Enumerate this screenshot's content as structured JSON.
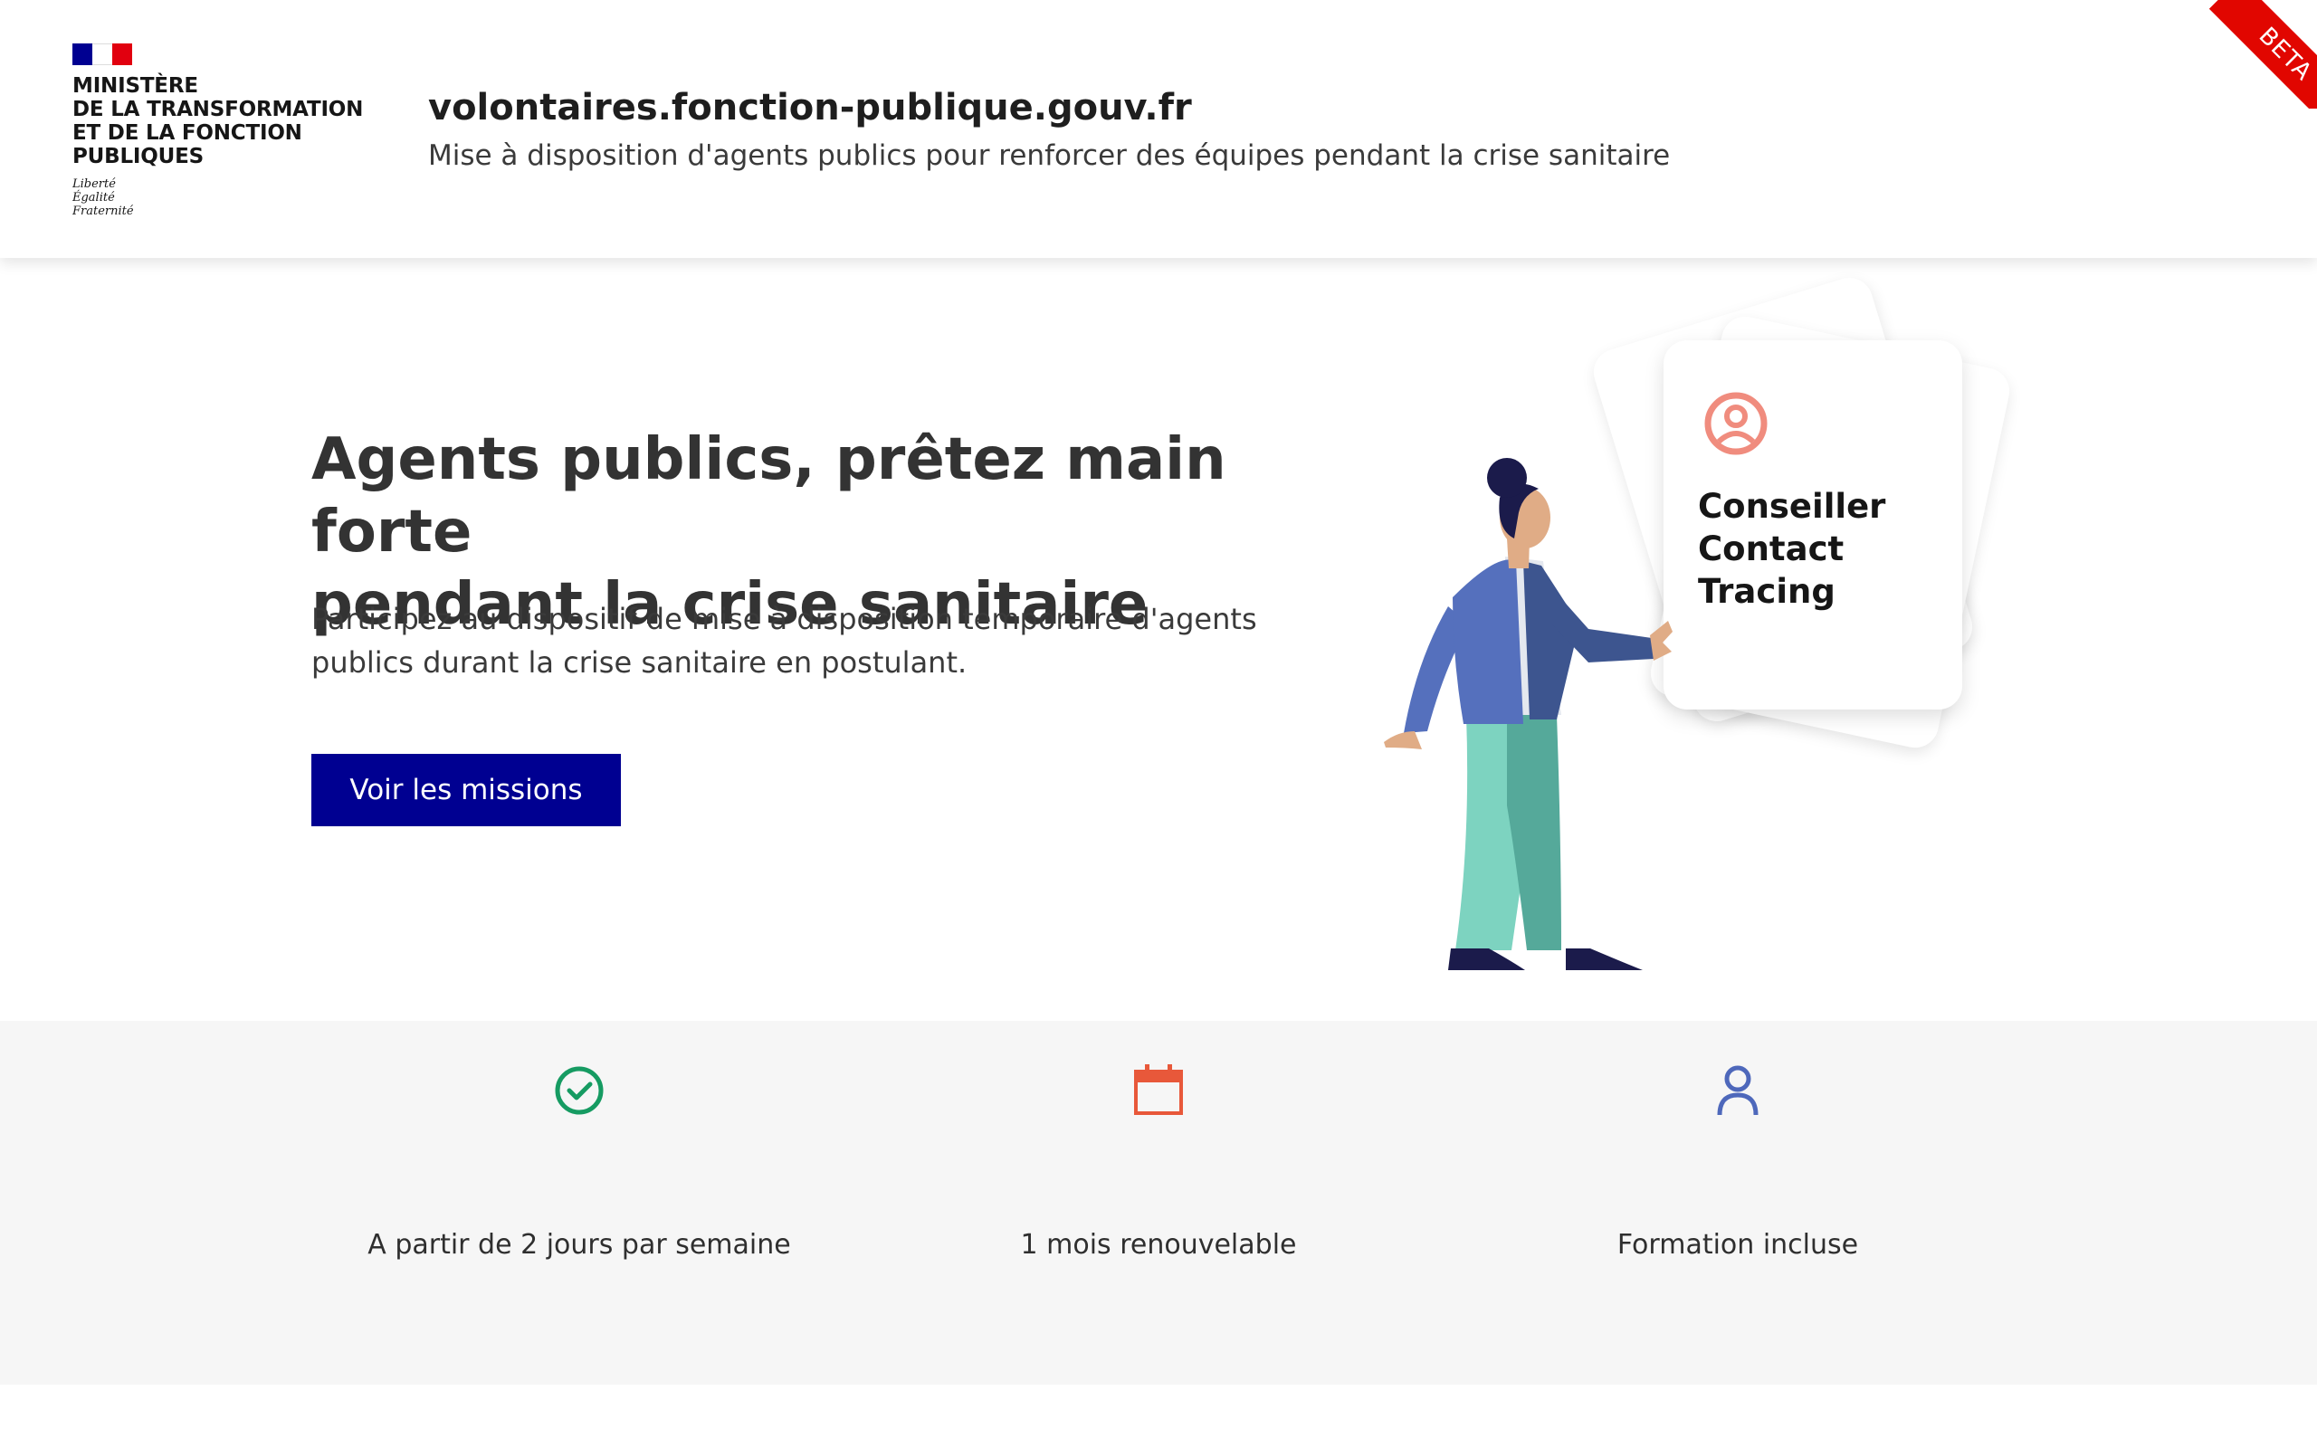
{
  "header": {
    "ministry": "MINISTÈRE\nDE LA TRANSFORMATION\nET DE LA FONCTION\nPUBLIQUES",
    "motto": "Liberté\nÉgalité\nFraternité",
    "site_title": "volontaires.fonction-publique.gouv.fr",
    "site_subtitle": "Mise à disposition d'agents publics pour renforcer des équipes pendant la crise sanitaire",
    "beta_label": "BETA",
    "flag_colors": [
      "#000091",
      "#ffffff",
      "#e1000f"
    ]
  },
  "hero": {
    "title": "Agents publics, prêtez main forte\npendant la crise sanitaire",
    "text": "Participez au dispositif de mise à disposition temporaire d'agents\npublics durant la crise sanitaire en postulant.",
    "cta_label": "Voir les missions",
    "cta_color": "#000091"
  },
  "illustration": {
    "card_label": "Conseiller\nContact\nTracing",
    "card_icon": "user-circle-icon"
  },
  "features": [
    {
      "label": "A partir de 2 jours par semaine",
      "icon": "check-circle-icon",
      "color": "#169b62"
    },
    {
      "label": "1 mois renouvelable",
      "icon": "calendar-icon",
      "color": "#e8583a"
    },
    {
      "label": "Formation incluse",
      "icon": "user-icon",
      "color": "#4e68bb"
    }
  ]
}
